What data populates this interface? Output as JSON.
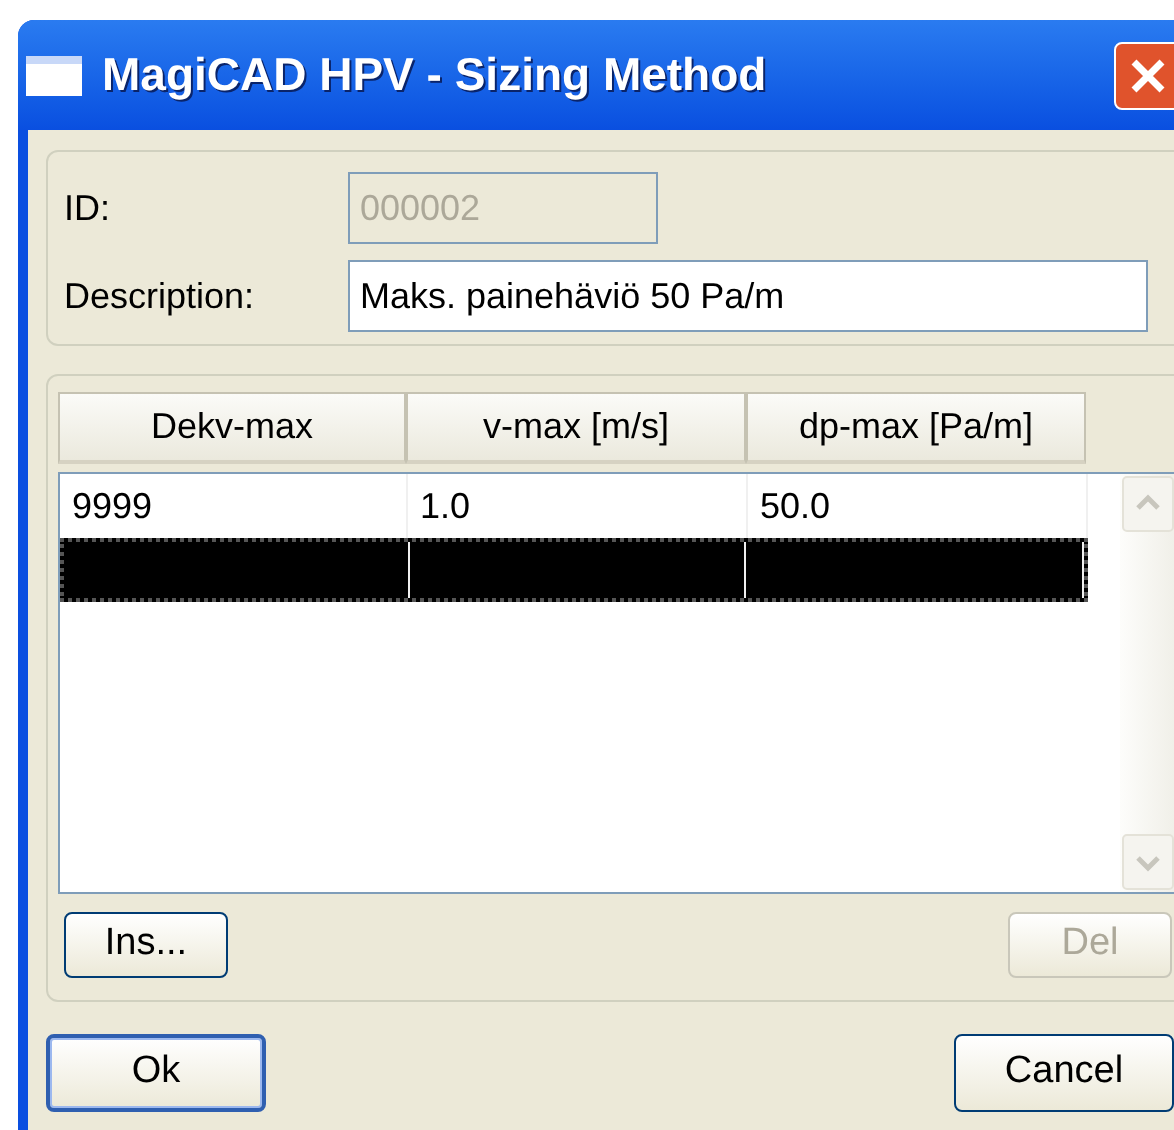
{
  "window": {
    "title": "MagiCAD HPV - Sizing Method"
  },
  "fields": [
    {
      "label": "ID:",
      "value": "000002",
      "disabled": true
    },
    {
      "label": "Description:",
      "value": "Maks. painehäviö 50 Pa/m",
      "disabled": false
    }
  ],
  "table": {
    "columns": [
      "Dekv-max",
      "v-max [m/s]",
      "dp-max [Pa/m]"
    ],
    "rows": [
      {
        "cells": [
          "9999",
          "1.0",
          "50.0"
        ],
        "selected": false
      },
      {
        "selected": true
      }
    ]
  },
  "table_buttons": [
    {
      "label": "Ins...",
      "disabled": false
    },
    {
      "label": "Del",
      "disabled": true
    }
  ],
  "buttons": [
    {
      "label": "Ok",
      "default": true
    },
    {
      "label": "Cancel",
      "default": false
    }
  ]
}
